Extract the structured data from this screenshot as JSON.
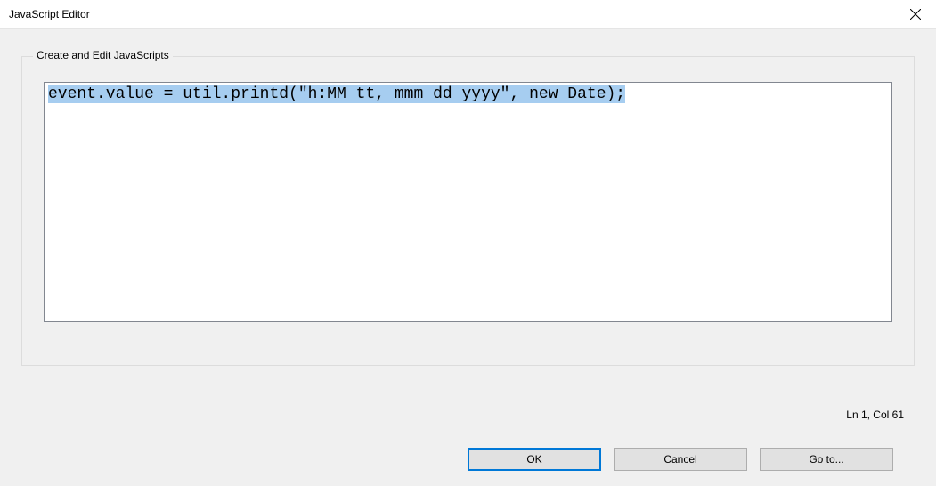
{
  "titlebar": {
    "title": "JavaScript Editor"
  },
  "fieldset": {
    "legend": "Create and Edit JavaScripts"
  },
  "editor": {
    "content": "event.value = util.printd(\"h:MM tt, mmm dd yyyy\", new Date);"
  },
  "status": {
    "text": "Ln 1, Col 61"
  },
  "buttons": {
    "ok": "OK",
    "cancel": "Cancel",
    "goto": "Go to..."
  }
}
